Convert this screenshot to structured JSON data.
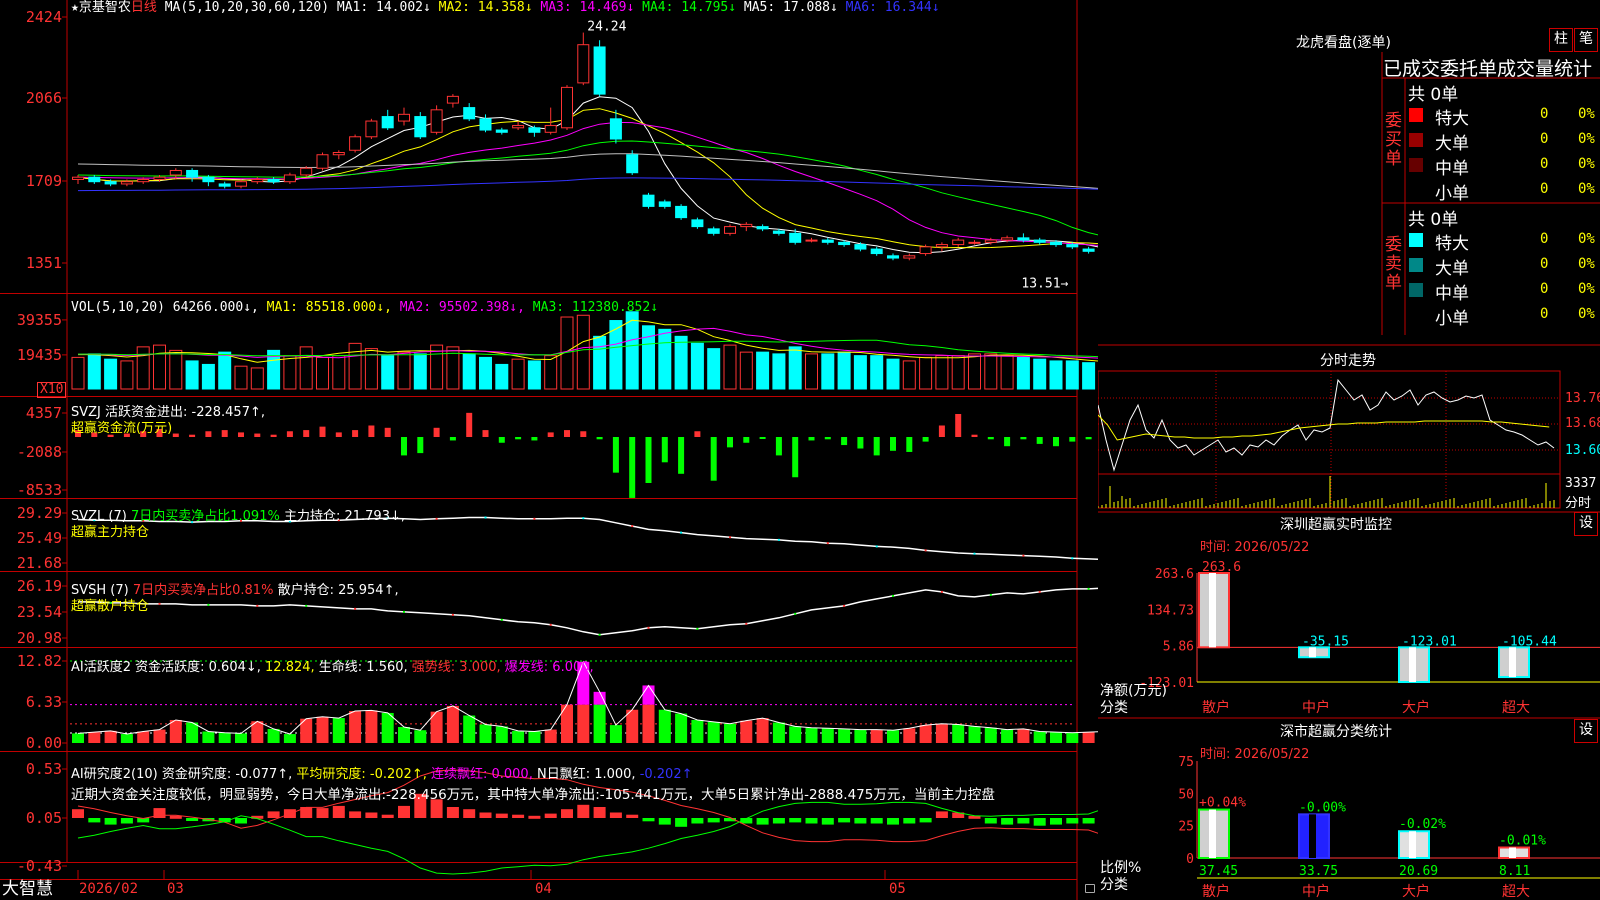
{
  "colors": {
    "up": "#ff3333",
    "down": "#00ffff",
    "ma1": "#ffffff",
    "ma2": "#ffff00",
    "ma3": "#ff00ff",
    "ma4": "#00ff00",
    "ma5": "#c0c0c0",
    "ma6": "#3333ff",
    "grid": "#c00000",
    "axis_text": "#ff3333",
    "green": "#00ff00",
    "magenta": "#ff00ff"
  },
  "main": {
    "star": "★",
    "stock_name": "京基智农",
    "period": "日线",
    "ma_title": "MA(5,10,20,30,60,120)",
    "ma_items": [
      {
        "text": "MA1: 14.002↓",
        "color": "#ffffff"
      },
      {
        "text": "MA2: 14.358↓",
        "color": "#ffff00"
      },
      {
        "text": "MA3: 14.469↓",
        "color": "#ff00ff"
      },
      {
        "text": "MA4: 14.795↓",
        "color": "#00ff00"
      },
      {
        "text": "MA5: 17.088↓",
        "color": "#c0c0c0"
      },
      {
        "text": "MA6: 16.344↓",
        "color": "#3333ff"
      }
    ],
    "y_ticks": [
      "2424",
      "2066",
      "1709",
      "1351"
    ],
    "high_label": "24.24",
    "low_label": "13.51"
  },
  "vol": {
    "title": "VOL(5,10,20)",
    "value": "64266.000↓,",
    "ma_items": [
      {
        "text": "MA1: 85518.000↓,",
        "color": "#ffff00"
      },
      {
        "text": "MA2: 95502.398↓,",
        "color": "#ff00ff"
      },
      {
        "text": "MA3: 112380.852↓",
        "color": "#00ff00"
      }
    ],
    "y_ticks": [
      "39355",
      "19435"
    ],
    "unit": "X10"
  },
  "svzj": {
    "title": "SVZJ  活跃资金进出: -228.457↑,",
    "subtitle": "超赢资金流(万元)",
    "y_ticks": [
      "4357",
      "-2088",
      "-8533"
    ]
  },
  "svzl": {
    "title_a": "SVZL (7) ",
    "title_b": "7日内买卖净占比1.091%",
    "title_c": " 主力持仓: 21.793↓,",
    "subtitle": "超赢主力持仓",
    "y_ticks": [
      "29.29",
      "25.49",
      "21.68"
    ]
  },
  "svsh": {
    "title_a": "SVSH (7) ",
    "title_b": "7日内买卖净占比0.81%",
    "title_c": " 散户持仓: 25.954↑,",
    "subtitle": "超赢散户持仓",
    "y_ticks": [
      "26.19",
      "23.54",
      "20.98"
    ]
  },
  "ai_active": {
    "title_a": "AI活跃度2 资金活跃度: 0.604↓,",
    "title_b": " 12.824,",
    "title_c": " 生命线: 1.560,",
    "title_d": " 强势线: 3.000,",
    "title_e": " 爆发线: 6.000,",
    "y_ticks": [
      "12.82",
      "6.33",
      "0.00"
    ]
  },
  "ai_research": {
    "title_a": "AI研究度2(10) 资金研究度: -0.077↑,",
    "title_b": " 平均研究度: -0.202↑,",
    "title_c": " 连续飘红: 0.000,",
    "title_d": " N日飘红: 1.000,",
    "title_e": " -0.202↑",
    "summary": "近期大资金关注度较低，明显弱势，今日大单净流出:-228.456万元，其中特大单净流出:-105.441万元，大单5日累计净出-2888.475万元，当前主力控盘",
    "y_ticks": [
      "0.53",
      "0.05",
      "-0.43"
    ]
  },
  "bottom_bar": {
    "brand": "大智慧",
    "dates": [
      "2026/02",
      "03",
      "04",
      "05"
    ]
  },
  "dragon_tiger": {
    "title": "龙虎看盘(逐单)",
    "btn_zhu": "柱",
    "btn_bi": "笔",
    "header": "已成交委托单成交量统计",
    "buy_label": "委买单",
    "sell_label": "委卖单",
    "buy_total": "共 0单",
    "sell_total": "共 0单",
    "buy_rows": [
      {
        "label": "特大",
        "count": "0",
        "pct": "0%",
        "color": "#ff0000"
      },
      {
        "label": "大单",
        "count": "0",
        "pct": "0%",
        "color": "#990000"
      },
      {
        "label": "中单",
        "count": "0",
        "pct": "0%",
        "color": "#660000"
      },
      {
        "label": "小单",
        "count": "0",
        "pct": "0%",
        "color": ""
      }
    ],
    "sell_rows": [
      {
        "label": "特大",
        "count": "0",
        "pct": "0%",
        "color": "#00ffff"
      },
      {
        "label": "大单",
        "count": "0",
        "pct": "0%",
        "color": "#008888"
      },
      {
        "label": "中单",
        "count": "0",
        "pct": "0%",
        "color": "#006666"
      },
      {
        "label": "小单",
        "count": "0",
        "pct": "0%",
        "color": ""
      }
    ]
  },
  "intraday": {
    "title": "分时走势",
    "price_labels": [
      "13.76",
      "13.68",
      "13.60"
    ],
    "vol_label": "3337",
    "vol_unit": "分时"
  },
  "sz_monitor": {
    "title": "深圳超赢实时监控",
    "btn": "设",
    "time_label": "时间: 2026/05/22",
    "y_ticks": [
      "263.6",
      "134.73",
      "5.86",
      "-123.01"
    ],
    "axis_label_1": "净额(万元)",
    "axis_label_2": "分类",
    "categories": [
      "散户",
      "中户",
      "大户",
      "超大"
    ],
    "value_labels": [
      "263.6",
      "-35.15",
      "-123.01",
      "-105.44"
    ],
    "chart_data": {
      "type": "bar",
      "categories": [
        "散户",
        "中户",
        "大户",
        "超大"
      ],
      "values": [
        263.6,
        -35.15,
        -123.01,
        -105.44
      ],
      "ylabel": "净额(万元)",
      "ylim": [
        -123.01,
        263.6
      ]
    }
  },
  "sz_class": {
    "title": "深市超赢分类统计",
    "btn": "设",
    "time_label": "时间: 2026/05/22",
    "y_ticks": [
      "75",
      "50",
      "25",
      "0"
    ],
    "axis_label_1": "比例%",
    "axis_label_2": "分类",
    "categories": [
      "散户",
      "中户",
      "大户",
      "超大"
    ],
    "change_labels": [
      "+0.04%",
      "-0.00%",
      "-0.02%",
      "-0.01%"
    ],
    "value_labels": [
      "37.45",
      "33.75",
      "20.69",
      "8.11"
    ],
    "chart_data": {
      "type": "bar",
      "categories": [
        "散户",
        "中户",
        "大户",
        "超大"
      ],
      "values": [
        37.45,
        33.75,
        20.69,
        8.11
      ],
      "ylabel": "比例%",
      "ylim": [
        0,
        75
      ]
    }
  },
  "series": {
    "candles": [
      [
        17.7,
        17.8,
        17.5,
        17.9
      ],
      [
        17.8,
        17.6,
        17.5,
        17.9
      ],
      [
        17.6,
        17.5,
        17.4,
        17.7
      ],
      [
        17.5,
        17.6,
        17.4,
        17.7
      ],
      [
        17.6,
        17.7,
        17.5,
        17.8
      ],
      [
        17.7,
        17.8,
        17.6,
        17.9
      ],
      [
        17.9,
        18.1,
        17.7,
        18.2
      ],
      [
        18.1,
        17.8,
        17.6,
        18.2
      ],
      [
        17.8,
        17.6,
        17.4,
        17.9
      ],
      [
        17.5,
        17.4,
        17.3,
        17.6
      ],
      [
        17.4,
        17.6,
        17.3,
        17.7
      ],
      [
        17.6,
        17.7,
        17.5,
        17.8
      ],
      [
        17.7,
        17.6,
        17.5,
        17.8
      ],
      [
        17.6,
        17.9,
        17.5,
        18.0
      ],
      [
        17.9,
        18.2,
        17.8,
        18.3
      ],
      [
        18.2,
        18.8,
        18.1,
        18.9
      ],
      [
        18.8,
        18.9,
        18.6,
        19.0
      ],
      [
        19.0,
        19.6,
        18.9,
        19.7
      ],
      [
        19.6,
        20.3,
        19.5,
        20.4
      ],
      [
        20.5,
        20.0,
        19.9,
        20.8
      ],
      [
        20.3,
        20.6,
        20.1,
        20.9
      ],
      [
        20.5,
        19.6,
        19.5,
        20.7
      ],
      [
        19.8,
        20.8,
        19.7,
        21.0
      ],
      [
        21.1,
        21.4,
        20.9,
        21.5
      ],
      [
        20.9,
        20.4,
        20.3,
        21.1
      ],
      [
        20.4,
        19.9,
        19.8,
        20.6
      ],
      [
        19.9,
        19.8,
        19.7,
        20.0
      ],
      [
        20.0,
        20.1,
        19.9,
        20.3
      ],
      [
        20.0,
        19.8,
        19.6,
        20.1
      ],
      [
        19.8,
        20.1,
        19.7,
        20.9
      ],
      [
        20.0,
        21.8,
        19.9,
        21.9
      ],
      [
        22.0,
        23.7,
        21.9,
        24.24
      ],
      [
        23.6,
        21.5,
        21.4,
        23.9
      ],
      [
        20.4,
        19.5,
        19.3,
        20.8
      ],
      [
        18.8,
        18.0,
        17.9,
        19.0
      ],
      [
        17.0,
        16.5,
        16.4,
        17.1
      ],
      [
        16.7,
        16.5,
        16.4,
        16.8
      ],
      [
        16.5,
        16.0,
        15.9,
        16.6
      ],
      [
        15.9,
        15.6,
        15.5,
        16.0
      ],
      [
        15.5,
        15.3,
        15.2,
        15.6
      ],
      [
        15.3,
        15.6,
        15.2,
        15.7
      ],
      [
        15.6,
        15.7,
        15.4,
        15.8
      ],
      [
        15.6,
        15.5,
        15.4,
        15.7
      ],
      [
        15.4,
        15.3,
        15.2,
        15.5
      ],
      [
        15.3,
        14.9,
        14.8,
        15.5
      ],
      [
        15.0,
        15.0,
        14.9,
        15.1
      ],
      [
        15.0,
        14.9,
        14.8,
        15.1
      ],
      [
        14.9,
        14.8,
        14.7,
        15.0
      ],
      [
        14.8,
        14.6,
        14.5,
        14.9
      ],
      [
        14.6,
        14.4,
        14.3,
        14.7
      ],
      [
        14.3,
        14.2,
        14.1,
        14.4
      ],
      [
        14.2,
        14.3,
        14.1,
        14.4
      ],
      [
        14.4,
        14.7,
        14.3,
        14.8
      ],
      [
        14.7,
        14.8,
        14.5,
        14.9
      ],
      [
        14.8,
        15.0,
        14.7,
        15.1
      ],
      [
        14.9,
        14.9,
        14.8,
        15.0
      ],
      [
        14.9,
        15.0,
        14.8,
        15.1
      ],
      [
        15.0,
        15.1,
        14.9,
        15.2
      ],
      [
        15.1,
        15.0,
        14.9,
        15.3
      ],
      [
        15.0,
        14.9,
        14.8,
        15.1
      ],
      [
        14.9,
        14.8,
        14.7,
        15.0
      ],
      [
        14.8,
        14.7,
        14.6,
        14.9
      ],
      [
        14.6,
        14.5,
        14.4,
        14.7
      ],
      [
        14.4,
        14.3,
        14.2,
        14.5
      ],
      [
        14.2,
        14.4,
        14.1,
        14.5
      ],
      [
        14.3,
        14.5,
        14.2,
        14.6
      ],
      [
        14.4,
        14.2,
        14.1,
        14.5
      ],
      [
        14.2,
        13.9,
        13.8,
        14.3
      ],
      [
        13.9,
        13.8,
        13.5,
        14.0
      ]
    ],
    "volume": [
      18000,
      20000,
      17000,
      16000,
      24000,
      25000,
      22000,
      16000,
      14000,
      21000,
      13000,
      12000,
      22000,
      19000,
      24000,
      18000,
      19000,
      26000,
      23000,
      19000,
      21000,
      20000,
      25000,
      24000,
      20000,
      18000,
      14000,
      17000,
      16000,
      19000,
      41000,
      42000,
      30000,
      39000,
      44000,
      36000,
      34000,
      30000,
      26000,
      23000,
      25000,
      21000,
      21000,
      20000,
      24000,
      20000,
      20000,
      21000,
      19000,
      19000,
      17000,
      16000,
      18000,
      19000,
      19000,
      20000,
      20000,
      19000,
      18000,
      17000,
      16000,
      16000,
      15000,
      14000,
      15000,
      16000,
      15000,
      14000,
      12000
    ],
    "svzj": [
      0.6,
      0.4,
      0.2,
      0.3,
      0.5,
      0.7,
      0.3,
      0.2,
      0.5,
      0.6,
      0.4,
      0.3,
      0.2,
      0.5,
      0.6,
      0.9,
      0.4,
      0.6,
      1.0,
      0.8,
      -1.6,
      -1.4,
      0.8,
      -0.3,
      2.1,
      0.6,
      -0.5,
      -0.2,
      -0.3,
      0.4,
      0.6,
      0.5,
      -0.2,
      -3.1,
      -5.3,
      -4.0,
      -2.2,
      -3.2,
      0.5,
      -3.8,
      -0.9,
      -0.5,
      -0.1,
      -1.6,
      -3.5,
      -0.3,
      -0.2,
      -0.7,
      -1.0,
      -1.6,
      -1.2,
      -1.3,
      -0.4,
      1.0,
      2.0,
      0.2,
      -0.2,
      -0.8,
      -0.2,
      -0.6,
      -0.8,
      -0.4,
      -0.2,
      -0.6,
      -0.7,
      -0.3,
      -0.5,
      -0.3,
      -0.3
    ],
    "svzl": [
      28.3,
      28.2,
      28.2,
      28.1,
      28.1,
      28.0,
      28.0,
      27.9,
      28.0,
      28.0,
      28.1,
      28.1,
      28.0,
      28.0,
      28.1,
      28.2,
      28.2,
      28.3,
      28.4,
      28.5,
      28.4,
      28.3,
      28.4,
      28.5,
      28.6,
      28.6,
      28.5,
      28.4,
      28.4,
      28.4,
      28.5,
      28.5,
      28.3,
      27.8,
      27.3,
      26.8,
      26.6,
      26.3,
      26.0,
      25.8,
      25.6,
      25.4,
      25.3,
      25.2,
      25.0,
      24.9,
      24.7,
      24.6,
      24.4,
      24.2,
      24.1,
      23.9,
      23.6,
      23.4,
      23.2,
      23.1,
      23.0,
      22.9,
      22.8,
      22.7,
      22.6,
      22.4,
      22.3,
      22.2,
      22.1,
      22.0,
      21.9,
      21.85,
      21.8
    ],
    "svsh": [
      24.6,
      24.6,
      24.5,
      24.5,
      24.4,
      24.4,
      24.4,
      24.3,
      24.3,
      24.3,
      24.3,
      24.2,
      24.2,
      24.3,
      24.2,
      24.1,
      24.0,
      23.9,
      23.9,
      23.7,
      23.6,
      23.5,
      23.4,
      23.3,
      23.2,
      23.0,
      22.8,
      22.6,
      22.5,
      22.3,
      22.0,
      21.6,
      21.3,
      21.5,
      21.7,
      22.0,
      22.1,
      22.0,
      21.9,
      22.1,
      22.3,
      22.4,
      22.7,
      23.0,
      23.4,
      23.8,
      24.0,
      24.2,
      24.6,
      24.9,
      25.2,
      25.5,
      25.8,
      25.6,
      25.2,
      25.1,
      25.3,
      25.5,
      25.4,
      25.6,
      25.8,
      25.9,
      25.9,
      26.0,
      26.0,
      25.9,
      26.0,
      26.0,
      26.0
    ],
    "ai_active": [
      1.5,
      1.7,
      1.9,
      1.4,
      1.8,
      2.1,
      3.6,
      3.2,
      1.8,
      1.6,
      1.5,
      3.4,
      2.2,
      1.4,
      3.8,
      4.1,
      3.9,
      5.0,
      5.1,
      4.7,
      2.5,
      2.0,
      4.9,
      5.8,
      4.3,
      2.9,
      2.6,
      1.9,
      1.8,
      2.1,
      6.0,
      12.7,
      8.0,
      2.8,
      5.2,
      9.0,
      5.2,
      4.6,
      3.6,
      3.3,
      3.0,
      3.5,
      3.9,
      3.2,
      2.6,
      2.4,
      2.3,
      2.2,
      2.1,
      2.1,
      2.0,
      2.3,
      2.8,
      3.0,
      2.9,
      2.6,
      2.4,
      2.1,
      2.2,
      1.8,
      1.7,
      1.6,
      1.7,
      1.8,
      1.5,
      1.4,
      1.1,
      0.8,
      0.6
    ],
    "ai_research": [
      0.08,
      -0.04,
      -0.06,
      -0.05,
      -0.04,
      0.09,
      0.02,
      -0.02,
      -0.03,
      -0.04,
      -0.05,
      0.02,
      0.06,
      0.08,
      0.1,
      0.09,
      0.11,
      0.06,
      0.05,
      0.03,
      0.11,
      0.22,
      0.17,
      0.1,
      0.08,
      0.05,
      0.04,
      0.03,
      0.02,
      0.04,
      0.08,
      0.12,
      0.1,
      0.05,
      0.03,
      -0.03,
      -0.06,
      -0.08,
      -0.05,
      -0.04,
      -0.03,
      -0.05,
      -0.06,
      -0.05,
      -0.04,
      -0.05,
      -0.06,
      -0.04,
      -0.05,
      -0.05,
      -0.06,
      -0.05,
      -0.04,
      0.06,
      0.05,
      0.02,
      -0.05,
      -0.06,
      -0.05,
      -0.07,
      -0.06,
      -0.05,
      -0.05,
      -0.06,
      -0.05,
      -0.07,
      -0.06,
      -0.08,
      -0.07
    ]
  }
}
